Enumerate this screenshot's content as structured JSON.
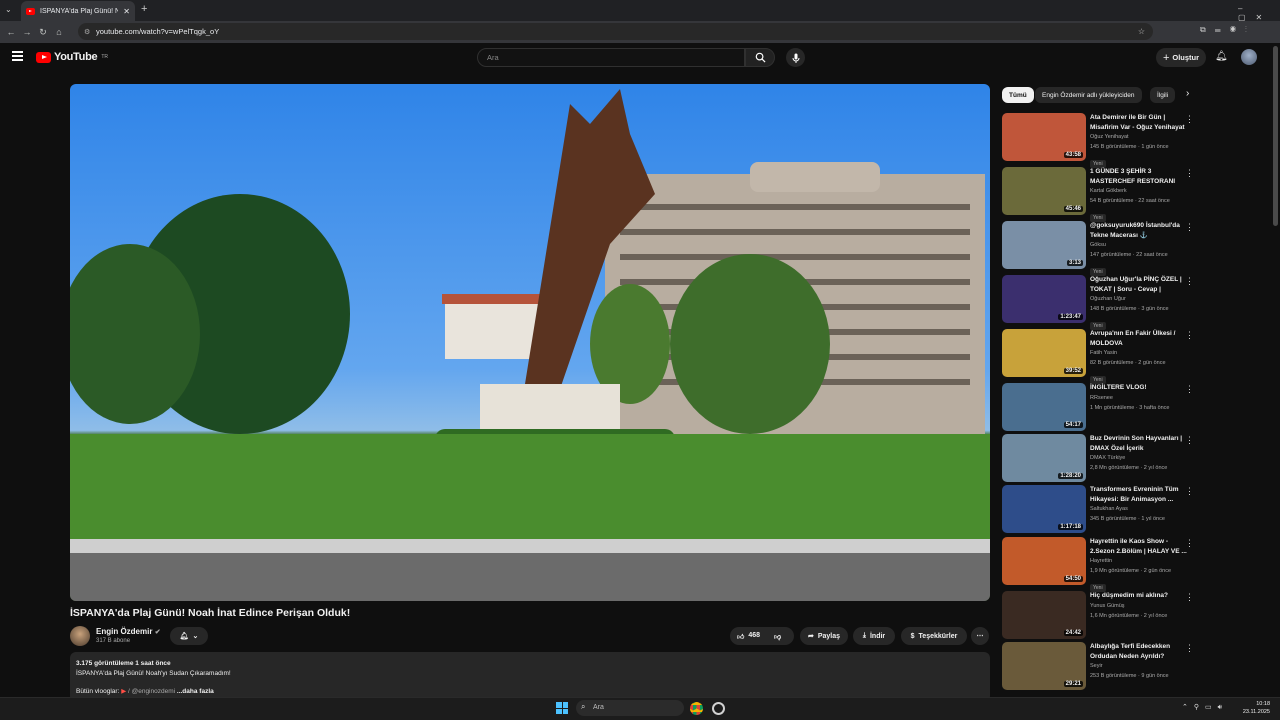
{
  "browser": {
    "tab_title": "İSPANYA'da Plaj Günü! Noah İnat",
    "url": "youtube.com/watch?v=wPelTqgk_oY"
  },
  "header": {
    "logo_text": "YouTube",
    "logo_sup": "TR",
    "search_placeholder": "Ara",
    "create_label": "Oluştur"
  },
  "video": {
    "title": "İSPANYA'da Plaj Günü! Noah İnat Edince Perişan Olduk!",
    "channel": "Engin Özdemir",
    "subscribers": "317 B abone",
    "likes": "468",
    "share": "Paylaş",
    "download": "İndir",
    "thanks": "Teşekkürler",
    "views_time": "3.175 görüntüleme  1 saat önce",
    "desc_line1": "İSPANYA'da Plaj Günü! Noah'yı Sudan Çıkaramadım!",
    "desc_line2_prefix": "Bütün vlooglar:",
    "desc_link": "/ @enginozdemi",
    "desc_more": "...daha fazla"
  },
  "chips": [
    "Tümü",
    "Engin Özdemir adlı yükleyiciden",
    "İlgili"
  ],
  "recommendations": [
    {
      "title": "Ata Demirer ile Bir Gün | Misafirim Var - Oğuz Yenihayat",
      "channel": "Oğuz Yenihayat",
      "meta": "145 B görüntüleme · 1 gün önce",
      "duration": "43:58",
      "badge": "Yeni",
      "color": "#c0563a"
    },
    {
      "title": "1 GÜNDE 3 ŞEHİR 3 MASTERCHEF RESTORANI",
      "channel": "Kartal Gökberk",
      "meta": "54 B görüntüleme · 22 saat önce",
      "duration": "45:46",
      "badge": "Yeni",
      "color": "#6b6a3a"
    },
    {
      "title": "@goksuyuruk690 İstanbul'da Tekne Macerası ⚓",
      "channel": "Göksu",
      "meta": "147 görüntüleme · 22 saat önce",
      "duration": "3:13",
      "badge": "Yeni",
      "color": "#7a8fa6"
    },
    {
      "title": "Oğuzhan Uğur'la PİNÇ ÖZEL | TOKAT | Soru - Cevap | Mehme...",
      "channel": "Oğuzhan Uğur",
      "meta": "148 B görüntüleme · 3 gün önce",
      "duration": "1:23:47",
      "badge": "Yeni",
      "color": "#3b2f6e"
    },
    {
      "title": "Avrupa'nın En Fakir Ülkesi / MOLDOVA",
      "channel": "Fatih Yasin",
      "meta": "82 B görüntüleme · 2 gün önce",
      "duration": "39:52",
      "badge": "Yeni",
      "color": "#c8a23a"
    },
    {
      "title": "İNGİLTERE VLOG!",
      "channel": "RRsenee",
      "meta": "1 Mn görüntüleme · 3 hafta önce",
      "duration": "54:17",
      "badge": "",
      "color": "#4a6e8f"
    },
    {
      "title": "Buz Devrinin Son Hayvanları | DMAX Özel İçerik",
      "channel": "DMAX Türkiye",
      "meta": "2,8 Mn görüntüleme · 2 yıl önce",
      "duration": "1:28:20",
      "badge": "",
      "color": "#6f8aa0"
    },
    {
      "title": "Transformers Evreninin Tüm Hikayesi: Bir Animasyon ...",
      "channel": "Saltukhan Ayas",
      "meta": "345 B görüntüleme · 1 yıl önce",
      "duration": "1:17:18",
      "badge": "",
      "color": "#2e4d8a"
    },
    {
      "title": "Hayrettin ile Kaos Show - 2.Sezon 2.Bölüm | HALAY VE ...",
      "channel": "Hayrettin",
      "meta": "1,9 Mn görüntüleme · 2 gün önce",
      "duration": "54:50",
      "badge": "Yeni",
      "color": "#c25a2a"
    },
    {
      "title": "Hiç düşmedim mi aklına?",
      "channel": "Yunus Gümüş",
      "meta": "1,6 Mn görüntüleme · 2 yıl önce",
      "duration": "24:42",
      "badge": "",
      "color": "#3a2a22"
    },
    {
      "title": "Albaylığa Terfi Edecekken Ordudan Neden Ayrıldı?",
      "channel": "Seyir",
      "meta": "253 B görüntüleme · 9 gün önce",
      "duration": "29:21",
      "badge": "",
      "color": "#6a5a3a"
    }
  ],
  "taskbar": {
    "search_placeholder": "Ara",
    "time": "10:18",
    "date": "23.11.2025"
  }
}
